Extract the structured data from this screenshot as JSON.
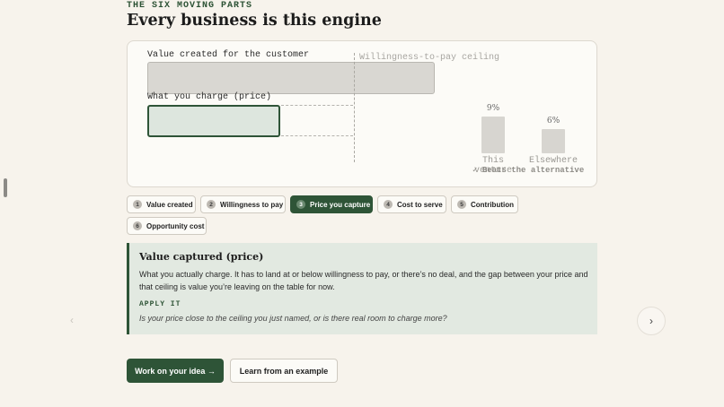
{
  "header": {
    "eyebrow": "THE SIX MOVING PARTS",
    "title": "Every business is this engine"
  },
  "diagram": {
    "value_label": "Value created for the customer",
    "ceiling_label": "Willingness-to-pay ceiling",
    "price_label": "What you charge (price)",
    "comparison": [
      {
        "label": "This venture",
        "pct": "9%",
        "value": 9
      },
      {
        "label": "Elsewhere",
        "pct": "6%",
        "value": 6
      }
    ],
    "beats_note": "✓ Beats the alternative"
  },
  "steps": [
    {
      "num": "1",
      "label": "Value created",
      "active": false
    },
    {
      "num": "2",
      "label": "Willingness to pay",
      "active": false
    },
    {
      "num": "3",
      "label": "Price you capture",
      "active": true
    },
    {
      "num": "4",
      "label": "Cost to serve",
      "active": false
    },
    {
      "num": "5",
      "label": "Contribution",
      "active": false
    },
    {
      "num": "6",
      "label": "Opportunity cost",
      "active": false
    }
  ],
  "panel": {
    "title": "Value captured (price)",
    "body": "What you actually charge. It has to land at or below willingness to pay, or there’s no deal, and the gap between your price and that ceiling is value you’re leaving on the table for now.",
    "apply_label": "APPLY IT",
    "apply_text": "Is your price close to the ceiling you just named, or is there real room to charge more?"
  },
  "nav": {
    "prev": "‹",
    "next": "›"
  },
  "actions": {
    "primary": "Work on your idea →",
    "secondary": "Learn from an example"
  },
  "colors": {
    "accent": "#2e5437",
    "panel_bg": "#e2e9e1",
    "page_bg": "#f7f3ec"
  }
}
